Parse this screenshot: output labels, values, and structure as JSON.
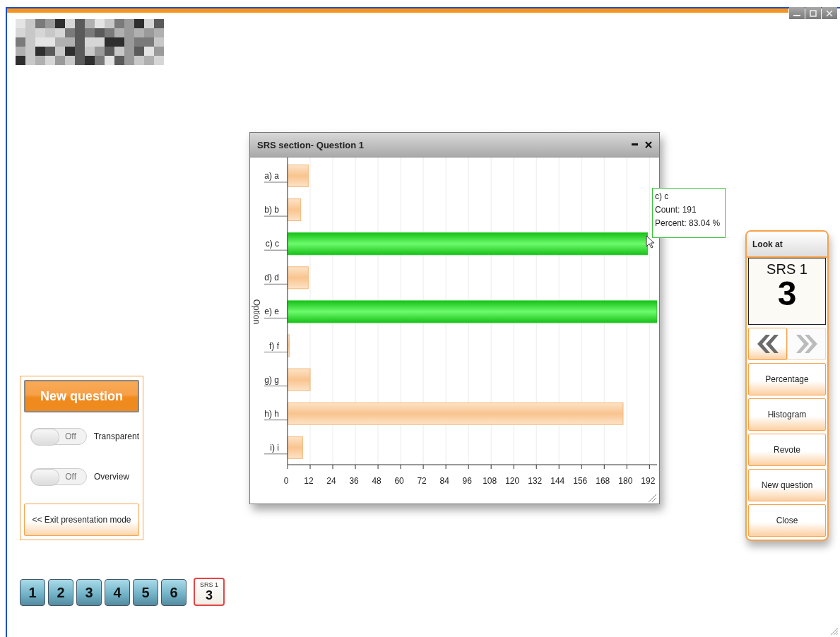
{
  "chart_window": {
    "title": "SRS section- Question 1",
    "chart_data": {
      "type": "bar",
      "orientation": "horizontal",
      "grid": true,
      "ylabel": "Option",
      "categories": [
        "a) a",
        "b) b",
        "c) c",
        "d) d",
        "e) e",
        "f) f",
        "g) g",
        "h) h",
        "i) i"
      ],
      "values": [
        11,
        7,
        191,
        11,
        196,
        1,
        12,
        178,
        8
      ],
      "xlim": [
        0,
        196
      ],
      "xticks": [
        0,
        12,
        24,
        36,
        48,
        60,
        72,
        84,
        96,
        108,
        120,
        132,
        144,
        156,
        168,
        180,
        192
      ]
    },
    "bars": [
      {
        "selected": false
      },
      {
        "selected": false
      },
      {
        "selected": true
      },
      {
        "selected": false
      },
      {
        "selected": true
      },
      {
        "selected": false
      },
      {
        "selected": false
      },
      {
        "selected": false
      },
      {
        "selected": false
      }
    ],
    "tooltip": [
      "c) c",
      "Count: 191",
      "Percent: 83.04 %"
    ]
  },
  "left_panel": {
    "new_question_button": "New question",
    "toggles": [
      {
        "label": "Transparent",
        "state_text": "Off",
        "on": false
      },
      {
        "label": "Overview",
        "state_text": "Off",
        "on": false
      }
    ],
    "exit_button": "<< Exit presentation mode"
  },
  "question_buttons": [
    {
      "kind": "number",
      "label": "1",
      "selected": false
    },
    {
      "kind": "number",
      "label": "2",
      "selected": false
    },
    {
      "kind": "number",
      "label": "3",
      "selected": false
    },
    {
      "kind": "number",
      "label": "4",
      "selected": false
    },
    {
      "kind": "number",
      "label": "5",
      "selected": false
    },
    {
      "kind": "number",
      "label": "6",
      "selected": false
    },
    {
      "kind": "srs",
      "title": "SRS 1",
      "label": "3",
      "selected": true
    }
  ],
  "side_panel": {
    "title": "Look at",
    "display": {
      "title": "SRS 1",
      "number": "3"
    },
    "previous_disabled": false,
    "next_disabled": true,
    "buttons": [
      "Percentage",
      "Histogram",
      "Revote",
      "New question",
      "Close"
    ]
  }
}
